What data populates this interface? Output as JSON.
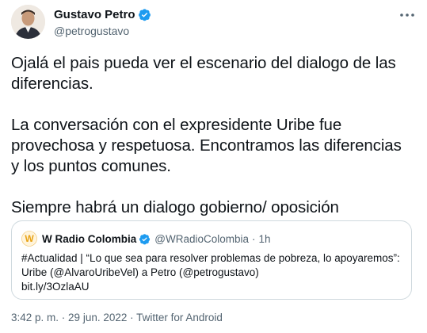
{
  "author": {
    "name": "Gustavo Petro",
    "handle": "@petrogustavo",
    "verified": true
  },
  "tweet": {
    "text": "Ojalá el pais pueda ver el escenario del dialogo de las\ndiferencias.\n\nLa conversación con el expresidente Uribe fue\nprovechosa y respetuosa. Encontramos las diferencias\ny los puntos comunes.\n\nSiempre habrá un dialogo gobierno/ oposición"
  },
  "quote": {
    "logo_text": "W",
    "name": "W Radio Colombia",
    "handle": "@WRadioColombia",
    "separator": "·",
    "time": "1h",
    "text": "#Actualidad | “Lo que sea para resolver problemas de pobreza, lo apoyaremos”:\nUribe (@AlvaroUribeVel) a Petro (@petrogustavo)\nbit.ly/3OzlaAU"
  },
  "meta": {
    "time": "3:42 p. m.",
    "date": "29 jun. 2022",
    "source": "Twitter for Android"
  },
  "colors": {
    "verified": "#1d9bf0",
    "secondary_text": "#536471",
    "border": "#cfd9de",
    "brand_w": "#e8a317"
  },
  "icons": {
    "more": "more-horizontal-icon",
    "verified": "verified-badge-icon"
  }
}
